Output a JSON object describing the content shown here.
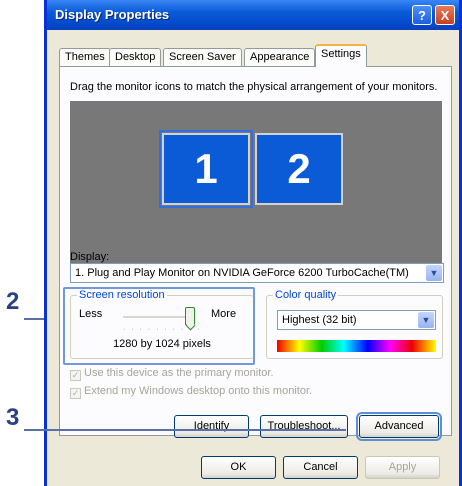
{
  "window": {
    "title": "Display Properties",
    "help_label": "?",
    "close_label": "X"
  },
  "tabs": [
    {
      "label": "Themes"
    },
    {
      "label": "Desktop"
    },
    {
      "label": "Screen Saver"
    },
    {
      "label": "Appearance"
    },
    {
      "label": "Settings",
      "active": true
    }
  ],
  "settings": {
    "instruction": "Drag the monitor icons to match the physical arrangement of your monitors.",
    "monitors": [
      {
        "number": "1",
        "selected": true
      },
      {
        "number": "2",
        "selected": false
      }
    ],
    "display_label": "Display:",
    "display_value": "1. Plug and Play Monitor on NVIDIA GeForce 6200 TurboCache(TM)",
    "resolution": {
      "group_label": "Screen resolution",
      "less": "Less",
      "more": "More",
      "value": "1280 by 1024 pixels",
      "slider_level": 1.0,
      "ticks": "· · · · · · · · · ·"
    },
    "color": {
      "group_label": "Color quality",
      "value": "Highest (32 bit)"
    },
    "primary_checkbox": "Use this device as the primary monitor.",
    "extend_checkbox": "Extend my Windows desktop onto this monitor.",
    "identify_button": "Identify",
    "troubleshoot_button": "Troubleshoot...",
    "advanced_button": "Advanced"
  },
  "footer": {
    "ok": "OK",
    "cancel": "Cancel",
    "apply": "Apply"
  },
  "callouts": {
    "two": "2",
    "three": "3"
  },
  "icons": {
    "dropdown": "chevron-down-icon",
    "check": "checkmark-icon"
  },
  "colors": {
    "titlebar": "#0a5bd8",
    "monitor": "#0a5bd5",
    "preview_bg": "#787878",
    "group_label": "#0046d5",
    "callout": "#2b3f85"
  }
}
